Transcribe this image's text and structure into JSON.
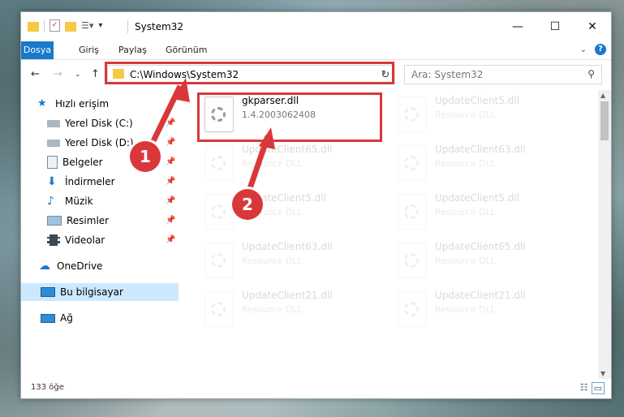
{
  "window": {
    "title": "System32"
  },
  "ribbon": {
    "tabs": [
      "Dosya",
      "Giriş",
      "Paylaş",
      "Görünüm"
    ],
    "help": "?"
  },
  "address": {
    "path": "C:\\Windows\\System32",
    "search_placeholder": "Ara: System32"
  },
  "sidebar": {
    "quick_access": "Hızlı erişim",
    "items": [
      "Yerel Disk (C:)",
      "Yerel Disk (D:)",
      "Belgeler",
      "İndirmeler",
      "Müzik",
      "Resimler",
      "Videolar"
    ],
    "onedrive": "OneDrive",
    "this_pc": "Bu bilgisayar",
    "network": "Ağ"
  },
  "files": {
    "main": {
      "name": "gkparser.dll",
      "type": "1.4.2003062408"
    },
    "ghosts": [
      {
        "name": "UpdateClient5.dll",
        "type": "Resource DLL"
      },
      {
        "name": "UpdateClient65.dll",
        "type": "Resource DLL"
      },
      {
        "name": "UpdateClient63.dll",
        "type": "Resource DLL"
      },
      {
        "name": "UpdateClient5.dll",
        "type": "Resource DLL"
      },
      {
        "name": "UpdateClient5.dll",
        "type": "Resource DLL"
      },
      {
        "name": "UpdateClient63.dll",
        "type": "Resource DLL"
      },
      {
        "name": "UpdateClient65.dll",
        "type": "Resource DLL"
      },
      {
        "name": "UpdateClient21.dll",
        "type": "Resource DLL"
      },
      {
        "name": "UpdateClient21.dll",
        "type": "Resource DLL"
      }
    ]
  },
  "status": {
    "count": "133 öğe"
  },
  "annotations": {
    "one": "1",
    "two": "2"
  },
  "colors": {
    "accent": "#1979ca",
    "highlight": "#d9383a"
  }
}
